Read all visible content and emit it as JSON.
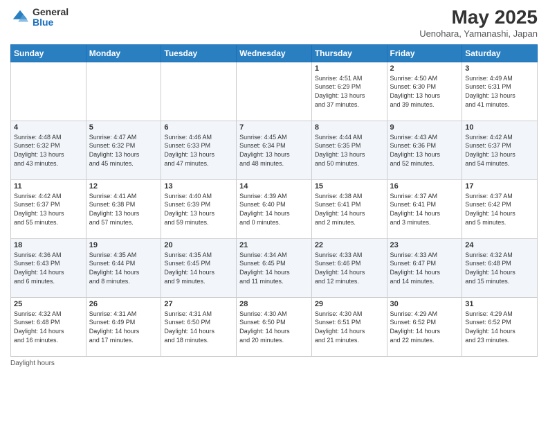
{
  "header": {
    "logo_general": "General",
    "logo_blue": "Blue",
    "month_year": "May 2025",
    "location": "Uenohara, Yamanashi, Japan"
  },
  "days_of_week": [
    "Sunday",
    "Monday",
    "Tuesday",
    "Wednesday",
    "Thursday",
    "Friday",
    "Saturday"
  ],
  "footer": {
    "daylight_label": "Daylight hours"
  },
  "weeks": [
    [
      {
        "num": "",
        "info": ""
      },
      {
        "num": "",
        "info": ""
      },
      {
        "num": "",
        "info": ""
      },
      {
        "num": "",
        "info": ""
      },
      {
        "num": "1",
        "info": "Sunrise: 4:51 AM\nSunset: 6:29 PM\nDaylight: 13 hours\nand 37 minutes."
      },
      {
        "num": "2",
        "info": "Sunrise: 4:50 AM\nSunset: 6:30 PM\nDaylight: 13 hours\nand 39 minutes."
      },
      {
        "num": "3",
        "info": "Sunrise: 4:49 AM\nSunset: 6:31 PM\nDaylight: 13 hours\nand 41 minutes."
      }
    ],
    [
      {
        "num": "4",
        "info": "Sunrise: 4:48 AM\nSunset: 6:32 PM\nDaylight: 13 hours\nand 43 minutes."
      },
      {
        "num": "5",
        "info": "Sunrise: 4:47 AM\nSunset: 6:32 PM\nDaylight: 13 hours\nand 45 minutes."
      },
      {
        "num": "6",
        "info": "Sunrise: 4:46 AM\nSunset: 6:33 PM\nDaylight: 13 hours\nand 47 minutes."
      },
      {
        "num": "7",
        "info": "Sunrise: 4:45 AM\nSunset: 6:34 PM\nDaylight: 13 hours\nand 48 minutes."
      },
      {
        "num": "8",
        "info": "Sunrise: 4:44 AM\nSunset: 6:35 PM\nDaylight: 13 hours\nand 50 minutes."
      },
      {
        "num": "9",
        "info": "Sunrise: 4:43 AM\nSunset: 6:36 PM\nDaylight: 13 hours\nand 52 minutes."
      },
      {
        "num": "10",
        "info": "Sunrise: 4:42 AM\nSunset: 6:37 PM\nDaylight: 13 hours\nand 54 minutes."
      }
    ],
    [
      {
        "num": "11",
        "info": "Sunrise: 4:42 AM\nSunset: 6:37 PM\nDaylight: 13 hours\nand 55 minutes."
      },
      {
        "num": "12",
        "info": "Sunrise: 4:41 AM\nSunset: 6:38 PM\nDaylight: 13 hours\nand 57 minutes."
      },
      {
        "num": "13",
        "info": "Sunrise: 4:40 AM\nSunset: 6:39 PM\nDaylight: 13 hours\nand 59 minutes."
      },
      {
        "num": "14",
        "info": "Sunrise: 4:39 AM\nSunset: 6:40 PM\nDaylight: 14 hours\nand 0 minutes."
      },
      {
        "num": "15",
        "info": "Sunrise: 4:38 AM\nSunset: 6:41 PM\nDaylight: 14 hours\nand 2 minutes."
      },
      {
        "num": "16",
        "info": "Sunrise: 4:37 AM\nSunset: 6:41 PM\nDaylight: 14 hours\nand 3 minutes."
      },
      {
        "num": "17",
        "info": "Sunrise: 4:37 AM\nSunset: 6:42 PM\nDaylight: 14 hours\nand 5 minutes."
      }
    ],
    [
      {
        "num": "18",
        "info": "Sunrise: 4:36 AM\nSunset: 6:43 PM\nDaylight: 14 hours\nand 6 minutes."
      },
      {
        "num": "19",
        "info": "Sunrise: 4:35 AM\nSunset: 6:44 PM\nDaylight: 14 hours\nand 8 minutes."
      },
      {
        "num": "20",
        "info": "Sunrise: 4:35 AM\nSunset: 6:45 PM\nDaylight: 14 hours\nand 9 minutes."
      },
      {
        "num": "21",
        "info": "Sunrise: 4:34 AM\nSunset: 6:45 PM\nDaylight: 14 hours\nand 11 minutes."
      },
      {
        "num": "22",
        "info": "Sunrise: 4:33 AM\nSunset: 6:46 PM\nDaylight: 14 hours\nand 12 minutes."
      },
      {
        "num": "23",
        "info": "Sunrise: 4:33 AM\nSunset: 6:47 PM\nDaylight: 14 hours\nand 14 minutes."
      },
      {
        "num": "24",
        "info": "Sunrise: 4:32 AM\nSunset: 6:48 PM\nDaylight: 14 hours\nand 15 minutes."
      }
    ],
    [
      {
        "num": "25",
        "info": "Sunrise: 4:32 AM\nSunset: 6:48 PM\nDaylight: 14 hours\nand 16 minutes."
      },
      {
        "num": "26",
        "info": "Sunrise: 4:31 AM\nSunset: 6:49 PM\nDaylight: 14 hours\nand 17 minutes."
      },
      {
        "num": "27",
        "info": "Sunrise: 4:31 AM\nSunset: 6:50 PM\nDaylight: 14 hours\nand 18 minutes."
      },
      {
        "num": "28",
        "info": "Sunrise: 4:30 AM\nSunset: 6:50 PM\nDaylight: 14 hours\nand 20 minutes."
      },
      {
        "num": "29",
        "info": "Sunrise: 4:30 AM\nSunset: 6:51 PM\nDaylight: 14 hours\nand 21 minutes."
      },
      {
        "num": "30",
        "info": "Sunrise: 4:29 AM\nSunset: 6:52 PM\nDaylight: 14 hours\nand 22 minutes."
      },
      {
        "num": "31",
        "info": "Sunrise: 4:29 AM\nSunset: 6:52 PM\nDaylight: 14 hours\nand 23 minutes."
      }
    ]
  ]
}
